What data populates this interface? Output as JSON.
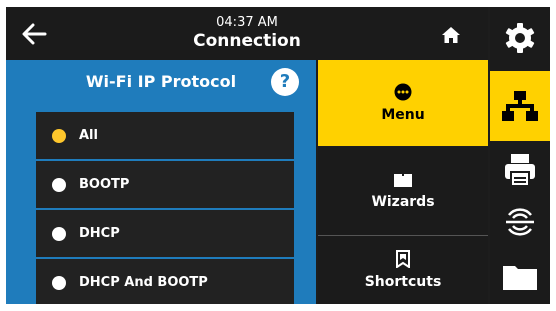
{
  "header": {
    "time": "04:37 AM",
    "title": "Connection",
    "back_icon": "arrow-left-icon",
    "home_icon": "home-icon"
  },
  "panel": {
    "title": "Wi-Fi IP Protocol",
    "help_label": "?",
    "options": [
      {
        "label": "All",
        "selected": true
      },
      {
        "label": "BOOTP",
        "selected": false
      },
      {
        "label": "DHCP",
        "selected": false
      },
      {
        "label": "DHCP And BOOTP",
        "selected": false
      }
    ]
  },
  "menu": {
    "items": [
      {
        "label": "Menu",
        "icon": "menu-dots-icon",
        "active": true
      },
      {
        "label": "Wizards",
        "icon": "book-icon",
        "active": false
      },
      {
        "label": "Shortcuts",
        "icon": "bookmark-icon",
        "active": false
      }
    ]
  },
  "sidebar": {
    "items": [
      {
        "icon": "gear-icon"
      },
      {
        "icon": "network-icon",
        "active": true
      },
      {
        "icon": "printer-icon"
      },
      {
        "icon": "rfid-icon"
      },
      {
        "icon": "folder-icon"
      }
    ]
  },
  "colors": {
    "accent": "#ffd100",
    "panel_blue": "#1f7cbc",
    "selected_radio": "#ffc72c",
    "background": "#1b1b1b"
  }
}
